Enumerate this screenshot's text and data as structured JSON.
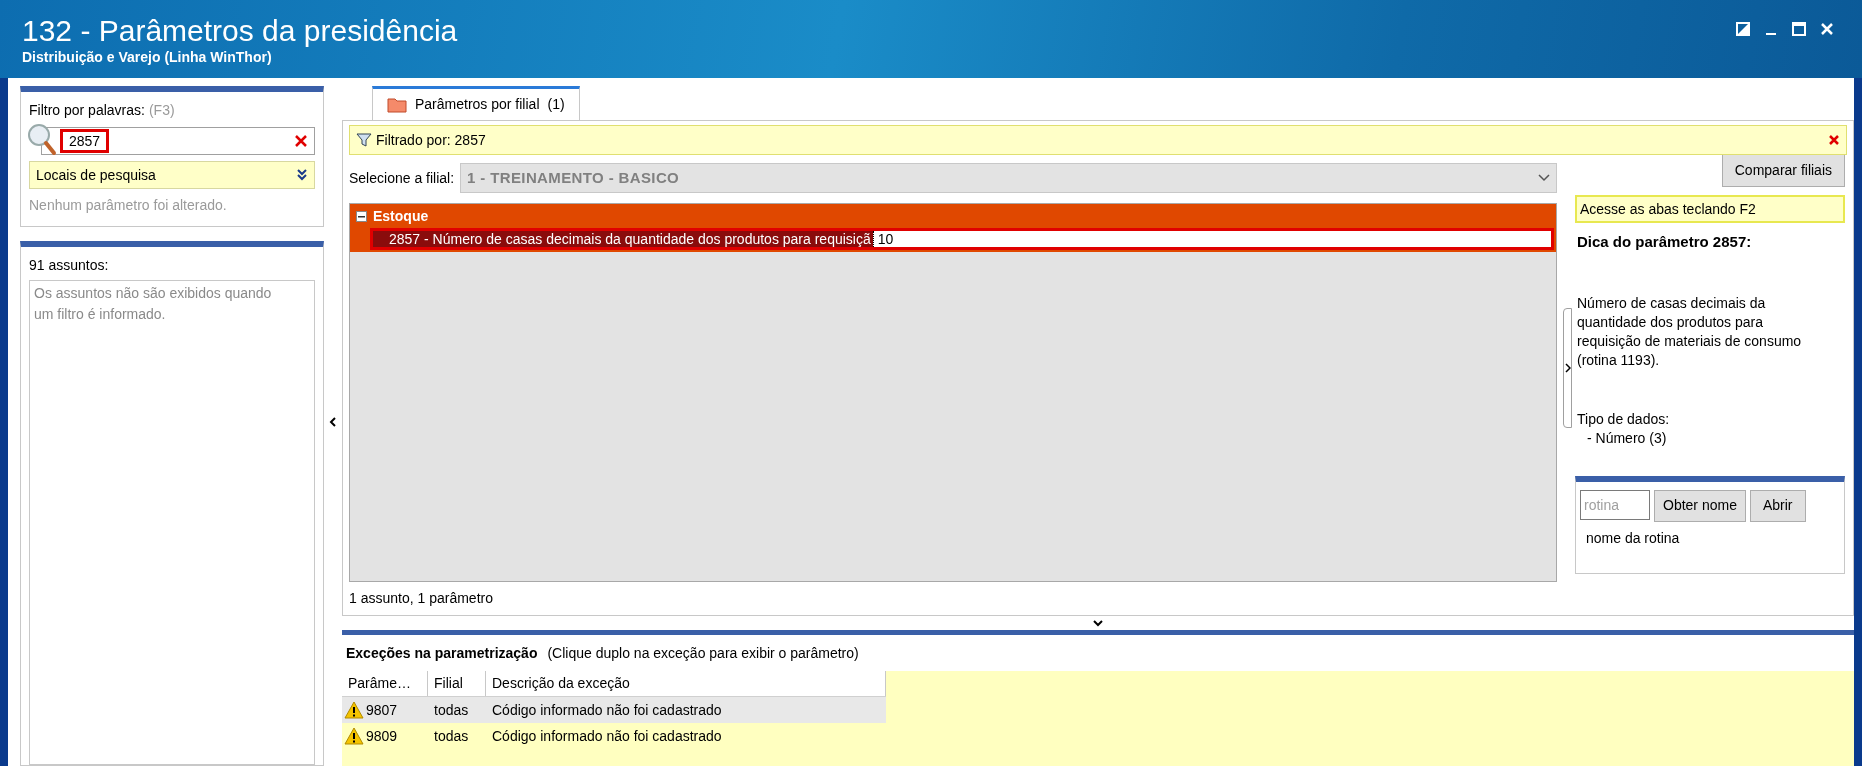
{
  "window": {
    "title": "132 - Parâmetros da presidência",
    "subtitle": "Distribuição e Varejo (Linha WinThor)"
  },
  "filter": {
    "label": "Filtro por palavras:",
    "shortcut": "(F3)",
    "value": "2857",
    "highlighted": true,
    "search_locations": "Locais de pesquisa",
    "status": "Nenhum parâmetro foi alterado."
  },
  "subjects": {
    "count_label": "91 assuntos:",
    "message": "Os assuntos não são exibidos quando um filtro é informado."
  },
  "tabs": [
    {
      "label": "Parâmetros por filial",
      "count": "(1)",
      "selected": true
    }
  ],
  "filter_bar": {
    "text": "Filtrado por: 2857"
  },
  "branch": {
    "label": "Selecione a filial:",
    "value": "1 - TREINAMENTO - BASICO",
    "disabled": true,
    "compare_button": "Comparar filiais"
  },
  "tree": [
    {
      "label": "Estoque",
      "expanded": true,
      "children": [
        {
          "label": "2857 - Número de casas decimais da quantidade dos produtos para requisiçã",
          "value": "10",
          "selected": true,
          "highlighted": true
        }
      ]
    }
  ],
  "tree_status": "1 assunto, 1 parâmetro",
  "hint": {
    "banner": "Acesse as abas teclando F2",
    "title": "Dica do parâmetro 2857:",
    "description": "Número de casas decimais da quantidade dos produtos para requisição de materiais de consumo (rotina 1193).",
    "data_type_label": "Tipo de dados:",
    "data_type": "- Número (3)"
  },
  "routine": {
    "placeholder": "rotina",
    "get_name_button": "Obter nome",
    "open_button": "Abrir",
    "name_label": "nome da rotina"
  },
  "exceptions": {
    "title": "Exceções na parametrização",
    "note": "(Clique duplo na exceção para exibir o parâmetro)",
    "columns": [
      "Parâme…",
      "Filial",
      "Descrição da exceção"
    ],
    "rows": [
      {
        "param": "9807",
        "branch": "todas",
        "description": "Código informado não foi cadastrado",
        "selected": true
      },
      {
        "param": "9809",
        "branch": "todas",
        "description": "Código informado não foi cadastrado",
        "selected": false
      }
    ]
  }
}
